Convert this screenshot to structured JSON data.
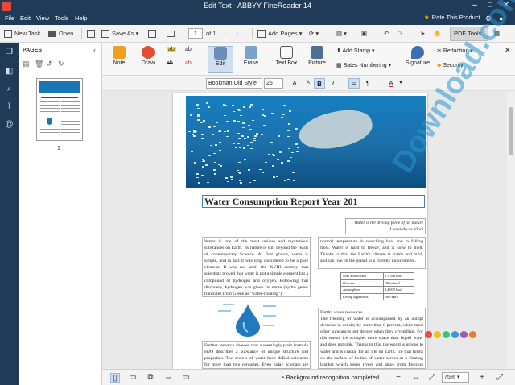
{
  "window": {
    "title": "Edit Text - ABBYY FineReader 14",
    "minimize": "–",
    "maximize": "□",
    "close": "✕"
  },
  "menu": {
    "items": [
      "File",
      "Edit",
      "View",
      "Tools",
      "Help"
    ],
    "rate": "Rate This Product"
  },
  "toolbar": {
    "new_task": "New Task",
    "open": "Open",
    "save_as": "Save As",
    "page_current": "1",
    "page_total": "of 1",
    "add_pages": "Add Pages",
    "pdf_tools": "PDF Tools"
  },
  "pages_panel": {
    "header": "PAGES",
    "thumb_label": "1"
  },
  "ribbon": {
    "note": "Note",
    "draw": "Draw",
    "edit": "Edit",
    "erase": "Erase",
    "text_box": "Text Box",
    "picture": "Picture",
    "add_stamp": "Add Stamp",
    "bates": "Bates Numbering",
    "signature": "Signature",
    "redaction": "Redaction",
    "security": "Security"
  },
  "format": {
    "font": "Bookman Old Style",
    "size": "25"
  },
  "document": {
    "title": "Water Consumption Report Year 201",
    "quote_line1": "Water is the driving force of all nature",
    "quote_line2": "Leonardo da Vinci",
    "para_left": "Water is one of the most unique and mysterious substances on Earth. Its nature is still beyond the reach of contemporary Science. At first glance, water is simple, and in fact it was long considered to be a pure element. It was not until the XVIII century that scientists proved that water is not a simple element but a compound of hydrogen and oxygen. Following that discovery, hydrogen was given its name (hydro genes translates from Greek as \"water-creating\").",
    "para_right": "normal temperature in scorching heat and in falling frost. Water is hard to freeze, and is slow to melt. Thanks to this, the Earth's climate is stable and mild, and can live on the planet in a friendly environment.",
    "table": [
      [
        "Seas and oceans",
        "1.4 bln km3"
      ],
      [
        "Glaciers",
        "30 m km3"
      ],
      [
        "Atmosphere",
        "14 000 km3"
      ],
      [
        "Living organisms",
        "900 km3"
      ]
    ],
    "para_right2": "Earth's water resources\nThe freezing of water is accompanied by an abrupt decrease in density by some than 8 percent, while most other substances get denser when they crystallize. For this reason ice occupies more space than liquid water and does not sink. Thanks to this, the world is unique to water and is crucial for all life on Earth. Ice that forms on the surface of bodies of water serves as a floating blanket which saves rivers and lakes from freezing completely and underwater",
    "para_left2": "Further research showed that a seemingly plain formula H2O describes a substance of unique structure and properties. The secrets of water have defied scientists for more than two centuries. Even today scholars are aware that water's"
  },
  "status": {
    "text": "Background recognition completed",
    "zoom": "75%"
  },
  "watermark": {
    "text": "Download.com.vn",
    "dot_colors": [
      "#e74c3c",
      "#f1c40f",
      "#2ecc71",
      "#3498db",
      "#9b59b6",
      "#e67e22"
    ]
  }
}
